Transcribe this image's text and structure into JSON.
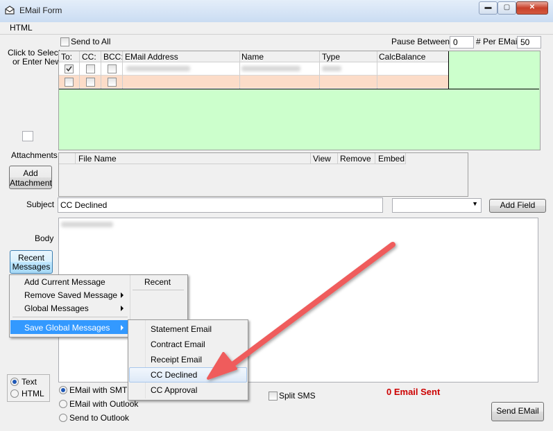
{
  "window": {
    "title": "EMail Form",
    "min": "▬",
    "max": "▢",
    "close": "✕"
  },
  "menubar": {
    "html": "HTML"
  },
  "top": {
    "send_to_all": "Send to All",
    "pause_between_label": "Pause Between",
    "pause_between_value": "0",
    "per_email_label": "# Per EMail",
    "per_email_value": "50"
  },
  "left": {
    "click_to_select_1": "Click to Select",
    "click_to_select_2": "or Enter New"
  },
  "recipients": {
    "headers": [
      "To:",
      "CC:",
      "BCC:",
      "EMail Address",
      "Name",
      "Type",
      "CalcBalance"
    ]
  },
  "attachments": {
    "label": "Attachments",
    "add_button_1": "Add",
    "add_button_2": "Attachment",
    "headers": [
      "File Name",
      "View",
      "Remove",
      "Embed"
    ]
  },
  "subject": {
    "label": "Subject",
    "value": "CC Declined",
    "add_field": "Add Field"
  },
  "body": {
    "label": "Body",
    "recent_1": "Recent",
    "recent_2": "Messages"
  },
  "context_menu": {
    "items": [
      "Add Current Message",
      "Remove Saved Message",
      "Global Messages",
      "Save Global Messages"
    ],
    "recent_header": "Recent"
  },
  "submenu": {
    "items": [
      "Statement Email",
      "Contract Email",
      "Receipt Email",
      "CC Declined",
      "CC Approval"
    ],
    "highlighted": "CC Declined"
  },
  "format": {
    "text": "Text",
    "html": "HTML"
  },
  "send_options": {
    "smtp": "EMail with SMTP",
    "outlook": "EMail with Outlook",
    "send_outlook": "Send to Outlook",
    "split_sms": "Split SMS"
  },
  "status": {
    "sent": "0 Email Sent",
    "color": "#cc0000"
  },
  "send_button": "Send EMail"
}
